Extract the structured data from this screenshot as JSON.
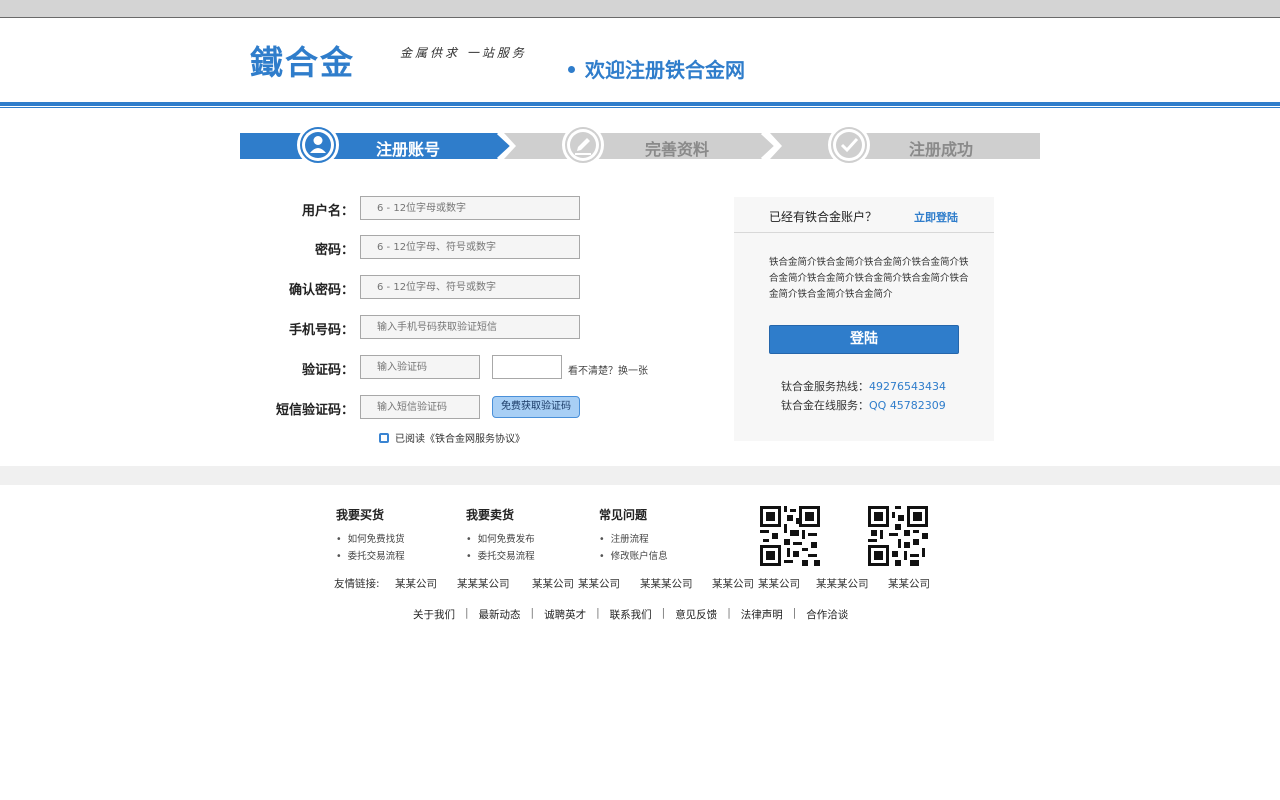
{
  "header": {
    "logo_text": "鐵合金",
    "slogan": "金属供求 一站服务",
    "welcome": "欢迎注册铁合金网"
  },
  "steps": [
    {
      "label": "注册账号",
      "active": true
    },
    {
      "label": "完善资料",
      "active": false
    },
    {
      "label": "注册成功",
      "active": false
    }
  ],
  "form": {
    "username": {
      "label": "用户名：",
      "placeholder": "6 - 12位字母或数字"
    },
    "password": {
      "label": "密码：",
      "placeholder": "6 - 12位字母、符号或数字"
    },
    "confirm": {
      "label": "确认密码：",
      "placeholder": "6 - 12位字母、符号或数字"
    },
    "phone": {
      "label": "手机号码：",
      "placeholder": "输入手机号码获取验证短信"
    },
    "captcha": {
      "label": "验证码：",
      "placeholder": "输入验证码",
      "refresh_text": "看不清楚？换一张"
    },
    "sms": {
      "label": "短信验证码：",
      "placeholder": "输入短信验证码",
      "button": "免费获取验证码"
    },
    "agree_text": "已阅读《铁合金网服务协议》"
  },
  "login_panel": {
    "question": "已经有铁合金账户？",
    "link": "立即登陆",
    "intro": "铁合金简介铁合金简介铁合金简介铁合金简介铁合金简介铁合金简介铁合金简介铁合金简介铁合金简介铁合金简介铁合金简介",
    "button": "登陆",
    "hotline_label": "钛合金服务热线：",
    "hotline_value": "49276543434",
    "online_label": "钛合金在线服务：",
    "online_value": "QQ 45782309"
  },
  "footer": {
    "columns": [
      {
        "title": "我要买货",
        "items": [
          "如何免费找货",
          "委托交易流程"
        ]
      },
      {
        "title": "我要卖货",
        "items": [
          "如何免费发布",
          "委托交易流程"
        ]
      },
      {
        "title": "常见问题",
        "items": [
          "注册流程",
          "修改账户信息"
        ]
      }
    ],
    "friend_label": "友情链接:",
    "friend_links": [
      "某某公司",
      "某某某公司",
      "某某公司",
      "某某公司",
      "某某某公司",
      "某某公司",
      "某某公司",
      "某某某公司",
      "某某公司"
    ],
    "nav": [
      "关于我们",
      "最新动态",
      "诚聘英才",
      "联系我们",
      "意见反馈",
      "法律声明",
      "合作洽谈"
    ]
  },
  "colors": {
    "accent": "#2f7dcb",
    "inactive_step": "#cfcfcf"
  }
}
